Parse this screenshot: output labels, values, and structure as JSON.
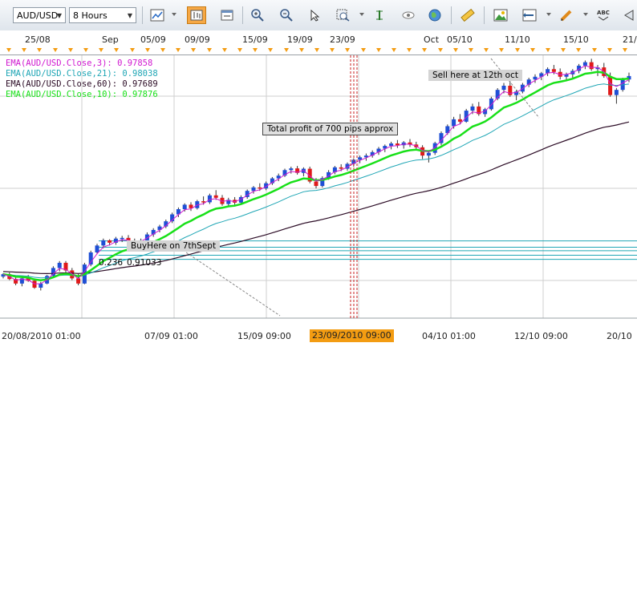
{
  "toolbar": {
    "symbol": "AUD/USD",
    "timeframe": "8 Hours",
    "buttons": [
      "chart-type-icon",
      "chart-bar-icon",
      "chart-window-icon",
      "zoom-in-icon",
      "zoom-out-icon",
      "cursor-icon",
      "zoom-area-icon",
      "vertical-line-icon",
      "eye-icon",
      "globe-icon",
      "ruler-icon",
      "picture-icon",
      "export-icon",
      "pencil-icon",
      "text-abc-icon",
      "arrow-left-icon"
    ],
    "text_button_label": "ABC"
  },
  "top_axis": [
    "25/08",
    "Sep",
    "05/09",
    "09/09",
    "15/09",
    "19/09",
    "23/09",
    "Oct",
    "05/10",
    "11/10",
    "15/10",
    "21/"
  ],
  "legend": [
    {
      "text": "EMA(AUD/USD.Close,3): 0.97858",
      "color": "#d018d0"
    },
    {
      "text": "EMA(AUD/USD.Close,21): 0.98038",
      "color": "#1fa6b5"
    },
    {
      "text": "EMA(AUD/USD.Close,60): 0.97689",
      "color": "#2b0b25"
    },
    {
      "text": "EMA(AUD/USD.Close,10): 0.97876",
      "color": "#18e018"
    }
  ],
  "annotations": {
    "sell": "Sell here at 12th oct",
    "profit": "Total profit of 700 pips approx",
    "buy": "BuyHere on 7thSept",
    "fib_level": "0.236",
    "fib_price": "0.91033"
  },
  "bottom_axis": [
    "20/08/2010 01:00",
    "07/09 01:00",
    "15/09 09:00",
    "23/09/2010 09:00",
    "04/10 01:00",
    "12/10 09:00",
    "20/10 "
  ],
  "chart_data": {
    "type": "candlestick",
    "instrument": "AUD/USD",
    "timeframe": "8 Hours",
    "candles": [
      [
        0.9,
        0.901,
        0.8995,
        0.9007
      ],
      [
        0.9007,
        0.9012,
        0.899,
        0.8993
      ],
      [
        0.8993,
        0.9,
        0.8975,
        0.898
      ],
      [
        0.898,
        0.8998,
        0.8972,
        0.8995
      ],
      [
        0.8995,
        0.9005,
        0.8985,
        0.8988
      ],
      [
        0.8988,
        0.8995,
        0.8965,
        0.8968
      ],
      [
        0.8968,
        0.8985,
        0.896,
        0.898
      ],
      [
        0.898,
        0.9005,
        0.8978,
        0.9002
      ],
      [
        0.9002,
        0.903,
        0.8998,
        0.9025
      ],
      [
        0.9025,
        0.9045,
        0.9015,
        0.904
      ],
      [
        0.904,
        0.9045,
        0.9012,
        0.9018
      ],
      [
        0.9018,
        0.9025,
        0.899,
        0.8995
      ],
      [
        0.8995,
        0.9008,
        0.8975,
        0.898
      ],
      [
        0.898,
        0.904,
        0.8978,
        0.9035
      ],
      [
        0.9035,
        0.9075,
        0.903,
        0.907
      ],
      [
        0.907,
        0.9095,
        0.9065,
        0.909
      ],
      [
        0.909,
        0.911,
        0.9082,
        0.9105
      ],
      [
        0.9105,
        0.9108,
        0.909,
        0.9098
      ],
      [
        0.9098,
        0.9115,
        0.9092,
        0.911
      ],
      [
        0.911,
        0.9118,
        0.91,
        0.9112
      ],
      [
        0.9112,
        0.912,
        0.9098,
        0.9104
      ],
      [
        0.9104,
        0.911,
        0.9085,
        0.9092
      ],
      [
        0.9092,
        0.911,
        0.9088,
        0.9105
      ],
      [
        0.9105,
        0.9128,
        0.91,
        0.9122
      ],
      [
        0.9122,
        0.914,
        0.9115,
        0.9135
      ],
      [
        0.9135,
        0.915,
        0.9128,
        0.9145
      ],
      [
        0.9145,
        0.9165,
        0.914,
        0.916
      ],
      [
        0.916,
        0.9185,
        0.9155,
        0.918
      ],
      [
        0.918,
        0.92,
        0.9172,
        0.9195
      ],
      [
        0.9195,
        0.9212,
        0.9188,
        0.9208
      ],
      [
        0.9208,
        0.9215,
        0.919,
        0.9198
      ],
      [
        0.9198,
        0.9222,
        0.9194,
        0.9218
      ],
      [
        0.9218,
        0.9232,
        0.9208,
        0.9215
      ],
      [
        0.9215,
        0.924,
        0.921,
        0.9235
      ],
      [
        0.9235,
        0.925,
        0.9222,
        0.9228
      ],
      [
        0.9228,
        0.9236,
        0.9205,
        0.921
      ],
      [
        0.921,
        0.9228,
        0.9205,
        0.9222
      ],
      [
        0.9222,
        0.923,
        0.9208,
        0.9214
      ],
      [
        0.9214,
        0.9235,
        0.921,
        0.923
      ],
      [
        0.923,
        0.9252,
        0.9225,
        0.9248
      ],
      [
        0.9248,
        0.9262,
        0.924,
        0.9258
      ],
      [
        0.9258,
        0.927,
        0.9248,
        0.9255
      ],
      [
        0.9255,
        0.9275,
        0.925,
        0.927
      ],
      [
        0.927,
        0.9288,
        0.9265,
        0.9284
      ],
      [
        0.9284,
        0.9298,
        0.9276,
        0.9292
      ],
      [
        0.9292,
        0.9312,
        0.9288,
        0.9308
      ],
      [
        0.9308,
        0.9318,
        0.9298,
        0.9313
      ],
      [
        0.9313,
        0.932,
        0.9295,
        0.93
      ],
      [
        0.93,
        0.9316,
        0.929,
        0.9312
      ],
      [
        0.9312,
        0.9318,
        0.927,
        0.9275
      ],
      [
        0.9275,
        0.9285,
        0.9255,
        0.9262
      ],
      [
        0.9262,
        0.929,
        0.9258,
        0.9285
      ],
      [
        0.9285,
        0.9308,
        0.928,
        0.9302
      ],
      [
        0.9302,
        0.932,
        0.9296,
        0.9316
      ],
      [
        0.9316,
        0.9325,
        0.9305,
        0.9312
      ],
      [
        0.9312,
        0.933,
        0.9306,
        0.9326
      ],
      [
        0.9326,
        0.9342,
        0.9318,
        0.9338
      ],
      [
        0.9338,
        0.935,
        0.9328,
        0.9345
      ],
      [
        0.9345,
        0.9356,
        0.9335,
        0.935
      ],
      [
        0.935,
        0.9365,
        0.9344,
        0.936
      ],
      [
        0.936,
        0.9375,
        0.9352,
        0.937
      ],
      [
        0.937,
        0.9382,
        0.936,
        0.9378
      ],
      [
        0.9378,
        0.939,
        0.9368,
        0.9385
      ],
      [
        0.9385,
        0.9395,
        0.9372,
        0.938
      ],
      [
        0.938,
        0.9392,
        0.937,
        0.9388
      ],
      [
        0.9388,
        0.9398,
        0.9375,
        0.9382
      ],
      [
        0.9382,
        0.939,
        0.9365,
        0.9374
      ],
      [
        0.9374,
        0.938,
        0.934,
        0.935
      ],
      [
        0.935,
        0.9365,
        0.933,
        0.9358
      ],
      [
        0.9358,
        0.939,
        0.9352,
        0.9386
      ],
      [
        0.9386,
        0.942,
        0.938,
        0.9415
      ],
      [
        0.9415,
        0.944,
        0.941,
        0.9435
      ],
      [
        0.9435,
        0.9462,
        0.9428,
        0.9455
      ],
      [
        0.9455,
        0.947,
        0.944,
        0.9448
      ],
      [
        0.9448,
        0.9485,
        0.9445,
        0.948
      ],
      [
        0.948,
        0.95,
        0.947,
        0.9492
      ],
      [
        0.9492,
        0.9505,
        0.9465,
        0.947
      ],
      [
        0.947,
        0.9488,
        0.9462,
        0.9484
      ],
      [
        0.9484,
        0.952,
        0.948,
        0.9515
      ],
      [
        0.9515,
        0.9545,
        0.951,
        0.954
      ],
      [
        0.954,
        0.956,
        0.953,
        0.9552
      ],
      [
        0.9552,
        0.9565,
        0.952,
        0.9525
      ],
      [
        0.9525,
        0.954,
        0.951,
        0.9535
      ],
      [
        0.9535,
        0.956,
        0.953,
        0.9555
      ],
      [
        0.9555,
        0.9575,
        0.9548,
        0.957
      ],
      [
        0.957,
        0.9585,
        0.956,
        0.9578
      ],
      [
        0.9578,
        0.9592,
        0.9568,
        0.9588
      ],
      [
        0.9588,
        0.9605,
        0.958,
        0.96
      ],
      [
        0.96,
        0.9612,
        0.9585,
        0.9592
      ],
      [
        0.9592,
        0.9602,
        0.957,
        0.9578
      ],
      [
        0.9578,
        0.959,
        0.9565,
        0.9585
      ],
      [
        0.9585,
        0.96,
        0.9575,
        0.9595
      ],
      [
        0.9595,
        0.9615,
        0.9588,
        0.961
      ],
      [
        0.961,
        0.9625,
        0.96,
        0.962
      ],
      [
        0.962,
        0.963,
        0.9595,
        0.96
      ],
      [
        0.96,
        0.9612,
        0.958,
        0.9605
      ],
      [
        0.9605,
        0.9618,
        0.9575,
        0.958
      ],
      [
        0.958,
        0.959,
        0.952,
        0.9525
      ],
      [
        0.9525,
        0.9545,
        0.95,
        0.954
      ],
      [
        0.954,
        0.9575,
        0.9535,
        0.957
      ],
      [
        0.957,
        0.959,
        0.9562,
        0.958
      ]
    ],
    "ema": {
      "3": 0.97858,
      "21": 0.98038,
      "60": 0.97689,
      "10": 0.97876
    },
    "fib_lines": [
      0.91033,
      0.9085,
      0.9075,
      0.9062,
      0.905
    ],
    "y_range": [
      0.888,
      0.964
    ],
    "bottom_time_axis": [
      "20/08/2010 01:00",
      "07/09 01:00",
      "15/09 09:00",
      "23/09/2010 09:00",
      "04/10 01:00",
      "12/10 09:00",
      "20/10 "
    ],
    "highlighted_time": "23/09/2010 09:00",
    "grid": true
  }
}
